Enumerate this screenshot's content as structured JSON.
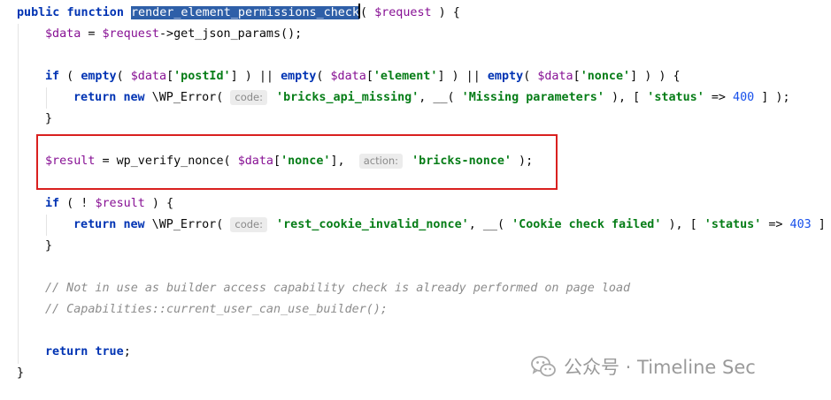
{
  "code": {
    "l1": {
      "public": "public",
      "function": "function",
      "fn_name": "render_element_permissions_check",
      "open": "( ",
      "param": "$request",
      "close": " ) {"
    },
    "l2": {
      "var": "$data",
      "eq": " = ",
      "req": "$request",
      "call": "->get_json_params();"
    },
    "l4": {
      "if": "if",
      "p1": " ( ",
      "empty1": "empty",
      "p2": "( ",
      "d1": "$data",
      "b1": "[",
      "k1": "'postId'",
      "b1c": "] ) || ",
      "empty2": "empty",
      "p3": "( ",
      "d2": "$data",
      "b2": "[",
      "k2": "'element'",
      "b2c": "] ) || ",
      "empty3": "empty",
      "p4": "( ",
      "d3": "$data",
      "b3": "[",
      "k3": "'nonce'",
      "b3c": "] ) ) {"
    },
    "l5": {
      "return": "return",
      "new": "new",
      "cls": " \\WP_Error( ",
      "hint": "code:",
      "code": "'bricks_api_missing'",
      "mid": ", __( ",
      "msg": "'Missing parameters'",
      "mid2": " ), [ ",
      "key": "'status'",
      "arrow": " => ",
      "num": "400",
      "end": " ] );"
    },
    "l6": {
      "brace": "}"
    },
    "l8": {
      "var": "$result",
      "eq": " = wp_verify_nonce( ",
      "d": "$data",
      "b": "[",
      "k": "'nonce'",
      "bc": "], ",
      "hint": "action:",
      "action": "'bricks-nonce'",
      "end": " );"
    },
    "l10": {
      "if": "if",
      "p1": " ( ! ",
      "var": "$result",
      "end": " ) {"
    },
    "l11": {
      "return": "return",
      "new": "new",
      "cls": " \\WP_Error( ",
      "hint": "code:",
      "code": "'rest_cookie_invalid_nonce'",
      "mid": ", __( ",
      "msg": "'Cookie check failed'",
      "mid2": " ), [ ",
      "key": "'status'",
      "arrow": " => ",
      "num": "403",
      "end": " ] "
    },
    "l12": {
      "brace": "}"
    },
    "l14": {
      "comment": "// Not in use as builder access capability check is already performed on page load"
    },
    "l15": {
      "comment": "// Capabilities::current_user_can_use_builder();"
    },
    "l17": {
      "return": "return",
      "true": "true",
      "end": ";"
    },
    "l18": {
      "brace": "}"
    }
  },
  "watermark": {
    "text": "公众号 · Timeline Sec",
    "icon": "wechat-icon"
  },
  "colors": {
    "keyword": "#0033b3",
    "variable": "#871094",
    "string": "#067d17",
    "number": "#1750eb",
    "comment": "#8c8c8c",
    "highlight_box": "#d9201f",
    "selection": "#2e5fa8"
  }
}
